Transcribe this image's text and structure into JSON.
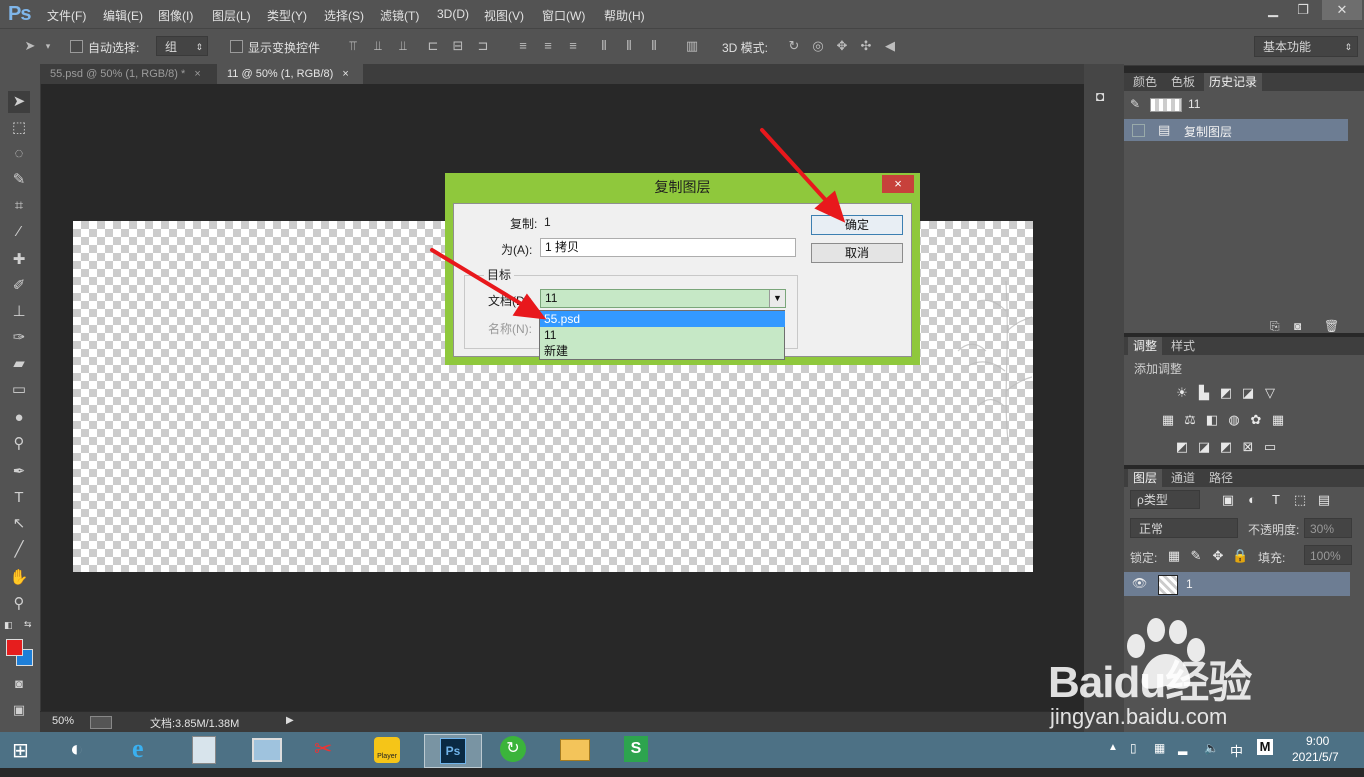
{
  "app": {
    "logo": "Ps"
  },
  "menu": [
    "文件(F)",
    "编辑(E)",
    "图像(I)",
    "图层(L)",
    "类型(Y)",
    "选择(S)",
    "滤镜(T)",
    "3D(D)",
    "视图(V)",
    "窗口(W)",
    "帮助(H)"
  ],
  "options": {
    "auto_select_label": "自动选择:",
    "auto_select_value": "组",
    "show_transform_label": "显示变换控件",
    "mode_3d_label": "3D 模式:",
    "workspace": "基本功能"
  },
  "tabs": [
    {
      "label": "55.psd @ 50% (1, RGB/8) *",
      "close": "×"
    },
    {
      "label": "11 @ 50% (1, RGB/8)",
      "close": "×"
    }
  ],
  "status": {
    "zoom": "50%",
    "doc": "文档:3.85M/1.38M"
  },
  "history_panel": {
    "tabs": [
      "颜色",
      "色板",
      "历史记录"
    ],
    "snapshot": "11",
    "items": [
      "复制图层"
    ]
  },
  "adjust_panel": {
    "tabs": [
      "调整",
      "样式"
    ],
    "title": "添加调整"
  },
  "layers_panel": {
    "tabs": [
      "图层",
      "通道",
      "路径"
    ],
    "filter": "ρ类型",
    "blend_mode": "正常",
    "opacity_label": "不透明度:",
    "opacity": "30%",
    "lock_label": "锁定:",
    "fill_label": "填充:",
    "fill": "100%",
    "layer_name": "1"
  },
  "dialog": {
    "title": "复制图层",
    "close": "×",
    "copy_label": "复制:",
    "copy_value": "1",
    "as_label": "为(A):",
    "as_value": "1 拷贝",
    "target_label": "目标",
    "doc_label": "文档(D):",
    "doc_value": "11",
    "name_label": "名称(N):",
    "ok": "确定",
    "cancel": "取消",
    "dropdown_options": [
      "55.psd",
      "11",
      "新建"
    ],
    "selected_option": "55.psd"
  },
  "watermark": {
    "text": "Baidu经验",
    "url": "jingyan.baidu.com"
  },
  "taskbar": {
    "time": "9:00",
    "date": "2021/5/7",
    "ime": "中",
    "ime2": "M"
  },
  "colors": {
    "foreground": "#e61e1e",
    "background": "#1e7fd8",
    "dialog_frame": "#8fc83c",
    "dropdown_bg": "#c6e8c6",
    "selected": "#3399ff"
  }
}
